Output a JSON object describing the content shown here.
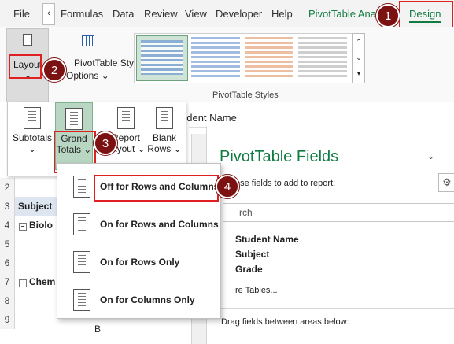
{
  "tabs": [
    "File",
    "Formulas",
    "Data",
    "Review",
    "View",
    "Developer",
    "Help",
    "PivotTable Anal",
    "Design"
  ],
  "ribbon": {
    "layout_label": "Layout",
    "layout_arrow": "⌄",
    "style_options_line1": "PivotTable Style",
    "style_options_line2": "Options ⌄",
    "styles_group_label": "PivotTable Styles"
  },
  "layout_menu": {
    "subtotals": "Subtotals",
    "subtotals_arrow": "⌄",
    "grand_line1": "Grand",
    "grand_line2": "Totals ⌄",
    "report_line1": "Report",
    "report_line2": "Layout ⌄",
    "blank_line1": "Blank",
    "blank_line2": "Rows ⌄"
  },
  "formula_bar_text": "udent Name",
  "dropdown_items": [
    "Off for Rows and Columns",
    "On for Rows and Columns",
    "On for Rows Only",
    "On for Columns Only"
  ],
  "sheet": {
    "rows": [
      "2",
      "3",
      "4",
      "5",
      "6",
      "7",
      "8",
      "9"
    ],
    "subject_label": "Subject",
    "biology": "Biolo",
    "chemistry": "Chem",
    "row9_value": "B"
  },
  "pivot": {
    "title": "PivotTable Fields",
    "choose_text": "ose fields to add to report:",
    "search_placeholder": "rch",
    "fields": [
      "Student Name",
      "Subject",
      "Grade"
    ],
    "more_tables": "re Tables...",
    "drag_text": "Drag fields between areas below:"
  },
  "markers": [
    "1",
    "2",
    "3",
    "4"
  ],
  "colors": {
    "pivot_tab": "#107c41",
    "marker": "#7b1111",
    "highlight": "#e02020",
    "active_button": "#b8d6c1"
  }
}
